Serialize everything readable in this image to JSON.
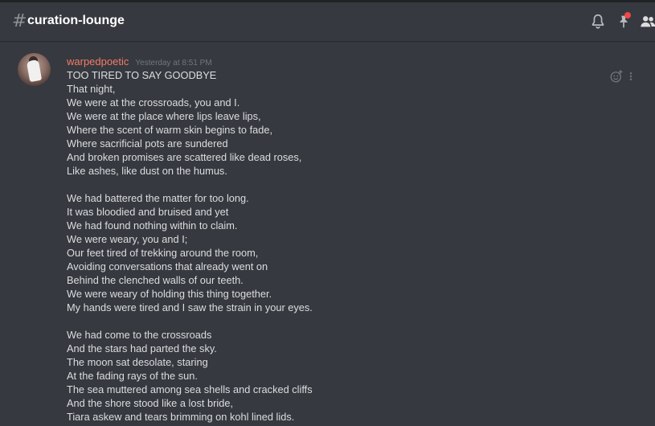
{
  "header": {
    "hash_symbol": "#",
    "channel_name": "curation-lounge",
    "icons": [
      "bell-icon",
      "pin-icon",
      "members-icon"
    ]
  },
  "message": {
    "username": "warpedpoetic",
    "timestamp": "Yesterday at 8:51 PM",
    "username_color": "#f47b67",
    "lines": [
      "TOO TIRED TO SAY GOODBYE",
      "That night,",
      "We were at the crossroads, you and I.",
      "We were at the place where lips leave lips,",
      "Where the scent of warm skin begins to fade,",
      "Where sacrificial pots are sundered",
      "And broken promises are scattered like dead roses,",
      "Like ashes, like dust on the humus.",
      "",
      "We had battered the matter for too long.",
      "It was bloodied and bruised and yet",
      "We had found nothing within to claim.",
      "We were weary, you and I;",
      "Our feet tired of trekking around the room,",
      "Avoiding conversations that already went on",
      "Behind the clenched walls of our teeth.",
      "We were weary of holding this thing together.",
      "My hands were tired and I saw the strain in your eyes.",
      "",
      "We had come to the crossroads",
      "And the stars had parted the sky.",
      "The moon sat desolate, staring",
      "At the fading rays of the sun.",
      "The sea muttered among sea shells and cracked cliffs",
      "And the shore stood like a lost bride,",
      "Tiara askew and tears brimming on kohl lined lids."
    ]
  },
  "actions": {
    "icons": [
      "add-reaction-icon",
      "more-options-icon"
    ]
  },
  "colors": {
    "background": "#36393f",
    "text": "#dcddde",
    "muted": "#72767d",
    "notification_dot": "#f04747"
  }
}
